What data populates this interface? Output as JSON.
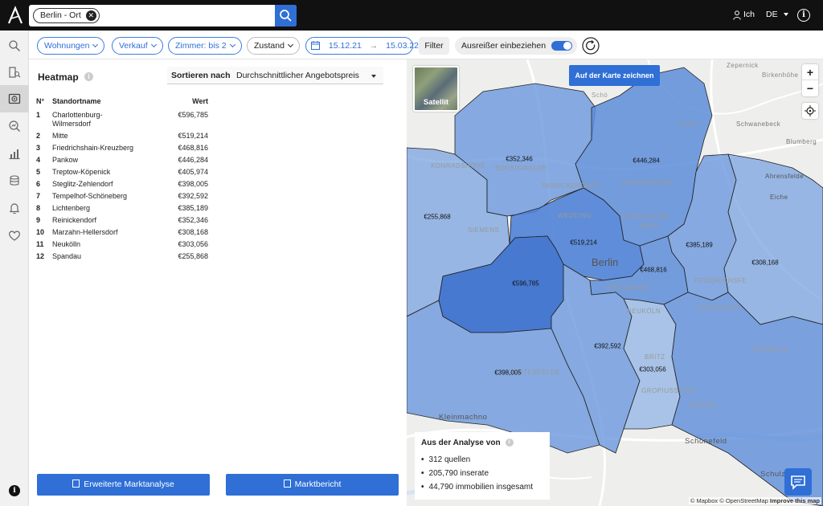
{
  "header": {
    "search_chip": "Berlin - Ort",
    "user_label": "Ich",
    "language": "DE"
  },
  "filters": {
    "property_type": "Wohnungen",
    "offer_type": "Verkauf",
    "rooms": "Zimmer: bis 2",
    "condition": "Zustand",
    "date_from": "15.12.21",
    "date_to": "15.03.22",
    "filter_button": "Filter",
    "outliers_label": "Ausreißer einbeziehen",
    "outliers_enabled": true
  },
  "panel": {
    "title": "Heatmap",
    "sort_label": "Sortieren nach",
    "sort_value": "Durchschnittlicher Angebotspreis",
    "columns": {
      "no": "N°",
      "name": "Standortname",
      "value": "Wert"
    },
    "rows": [
      {
        "no": "1",
        "name": "Charlottenburg-Wilmersdorf",
        "value": "€596,785"
      },
      {
        "no": "2",
        "name": "Mitte",
        "value": "€519,214"
      },
      {
        "no": "3",
        "name": "Friedrichshain-Kreuzberg",
        "value": "€468,816"
      },
      {
        "no": "4",
        "name": "Pankow",
        "value": "€446,284"
      },
      {
        "no": "5",
        "name": "Treptow-Köpenick",
        "value": "€405,974"
      },
      {
        "no": "6",
        "name": "Steglitz-Zehlendorf",
        "value": "€398,005"
      },
      {
        "no": "7",
        "name": "Tempelhof-Schöneberg",
        "value": "€392,592"
      },
      {
        "no": "8",
        "name": "Lichtenberg",
        "value": "€385,189"
      },
      {
        "no": "9",
        "name": "Reinickendorf",
        "value": "€352,346"
      },
      {
        "no": "10",
        "name": "Marzahn-Hellersdorf",
        "value": "€308,168"
      },
      {
        "no": "11",
        "name": "Neukölln",
        "value": "€303,056"
      },
      {
        "no": "12",
        "name": "Spandau",
        "value": "€255,868"
      }
    ],
    "button_market_analysis": "Erweiterte Marktanalyse",
    "button_market_report": "Marktbericht"
  },
  "map": {
    "satellite_label": "Satellit",
    "draw_button": "Auf der Karte zeichnen",
    "zoom_in": "+",
    "zoom_out": "−",
    "city": "Berlin",
    "place_labels": {
      "zepernick": "Zepernick",
      "birkenhohe": "Birkenhöhe",
      "schonwalde": "Schö",
      "schwanebeck": "Schwanebeck",
      "blumberg": "Blumberg",
      "ahrensfelde": "Ahrensfelde",
      "eiche": "Eiche",
      "karow": "KARO",
      "konradshohe": "KONRADSHÖHE",
      "borsigwalde": "BORSIGWALDE",
      "reinickendorf": "REINICKENDORF",
      "heinersdorf": "HEINERSDORF",
      "wedding": "WEDDING",
      "prenzlauer": "PRENZLAUER",
      "berg": "BERG",
      "siemensstadt": "SIEMENS",
      "friedrichsfelde": "FRIEDRICHSFE",
      "karlshorst": "KARLSHORS",
      "kreuzberg": "KREUZBERG",
      "neukolln": "NEUKÖLN",
      "lichterfelde": "LICHTERFELDE",
      "britz": "BRITZ",
      "gropiusstadt": "GROPIUSSTADT",
      "rudow": "RUDOW",
      "kopenick": "KÖPENICK",
      "kleinmachnow": "Kleinmachno",
      "schonefeld": "Schönefeld",
      "schulzendorf": "Schulz"
    },
    "price_labels": {
      "reinickendorf": "€352,346",
      "pankow": "€446,284",
      "spandau": "€255,868",
      "mitte": "€519,214",
      "lichtenberg": "€385,189",
      "charlottenburg": "€596,785",
      "friedrichshain": "€468,816",
      "marzahn": "€308,168",
      "tempelhof": "€392,592",
      "steglitz": "€398,005",
      "neukolln": "€303,056"
    },
    "analysis": {
      "title": "Aus der Analyse von",
      "items": [
        "312 quellen",
        "205,790 inserate",
        "44,790 immobilien insgesamt"
      ]
    },
    "attribution": {
      "mapbox": "© Mapbox",
      "osm": "© OpenStreetMap",
      "improve": "Improve this map"
    }
  },
  "colors": {
    "accent": "#2f6fd6",
    "topbar": "#111111"
  }
}
